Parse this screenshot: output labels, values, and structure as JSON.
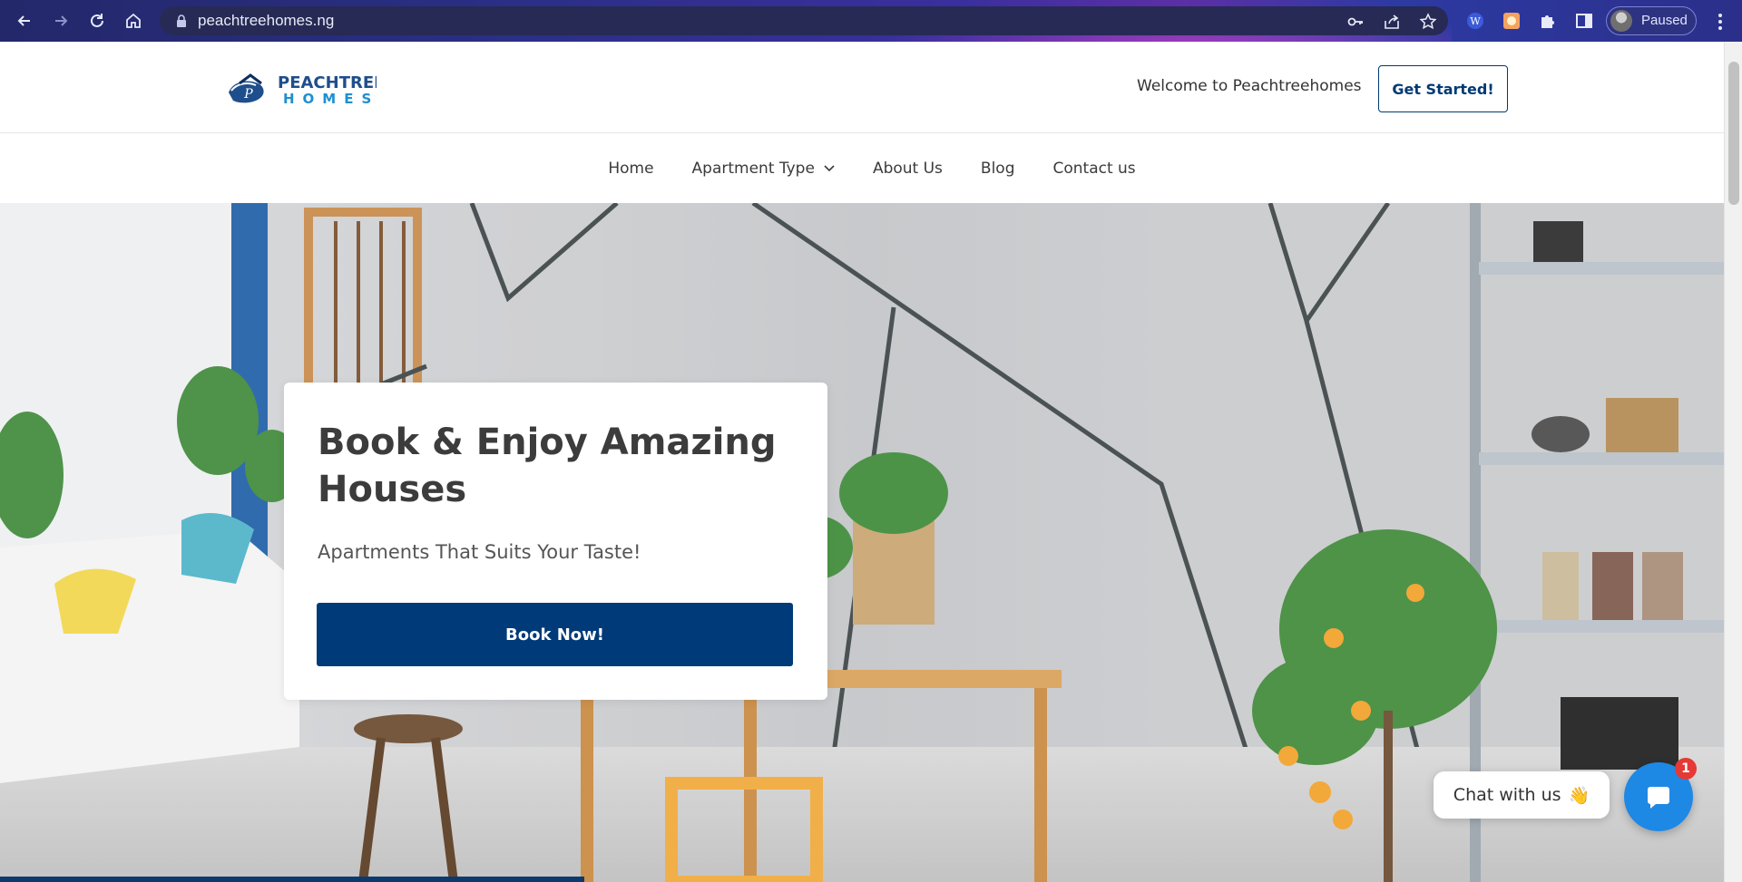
{
  "browser": {
    "url": "peachtreehomes.ng",
    "profile_status": "Paused",
    "icons": [
      "back-arrow-icon",
      "forward-arrow-icon",
      "reload-icon",
      "home-icon",
      "lock-icon",
      "key-icon",
      "share-icon",
      "star-icon",
      "wordpress-extension-icon",
      "extension-icon",
      "puzzle-icon",
      "side-panel-icon",
      "kebab-menu-icon"
    ]
  },
  "header": {
    "logo_text_top": "PEACHTREE",
    "logo_text_bottom": "HOMES",
    "welcome": "Welcome to Peachtreehomes",
    "cta": "Get Started!"
  },
  "nav": {
    "items": [
      {
        "label": "Home"
      },
      {
        "label": "Apartment Type",
        "has_dropdown": true
      },
      {
        "label": "About Us"
      },
      {
        "label": "Blog"
      },
      {
        "label": "Contact us"
      }
    ]
  },
  "hero": {
    "title": "Book & Enjoy Amazing Houses",
    "subtitle": "Apartments That Suits Your Taste!",
    "button": "Book Now!"
  },
  "chat": {
    "label": "Chat with us",
    "emoji": "👋",
    "badge": "1"
  },
  "colors": {
    "brand_blue": "#003a78",
    "chat_blue": "#1e88e5",
    "badge_red": "#e53935"
  }
}
